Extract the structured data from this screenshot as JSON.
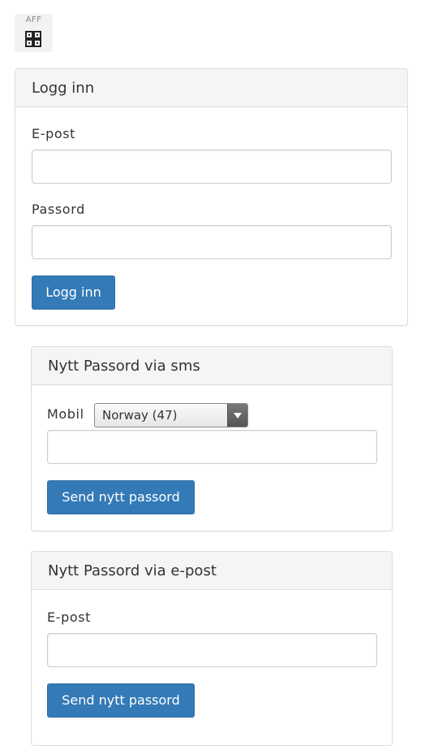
{
  "logo": {
    "text": "AFF",
    "icon": "qr-grid-icon"
  },
  "login_panel": {
    "title": "Logg inn",
    "email_label": "E-post",
    "email_value": "",
    "password_label": "Passord",
    "password_value": "",
    "submit_label": "Logg inn"
  },
  "sms_panel": {
    "title": "Nytt Passord via sms",
    "mobile_label": "Mobil",
    "country_selected": "Norway (47)",
    "phone_value": "",
    "submit_label": "Send nytt passord"
  },
  "email_panel": {
    "title": "Nytt Passord via e-post",
    "email_label": "E-post",
    "email_value": "",
    "submit_label": "Send nytt passord"
  },
  "colors": {
    "primary_button": "#337ab7",
    "panel_heading_bg": "#f5f5f5",
    "panel_border": "#dddddd"
  }
}
